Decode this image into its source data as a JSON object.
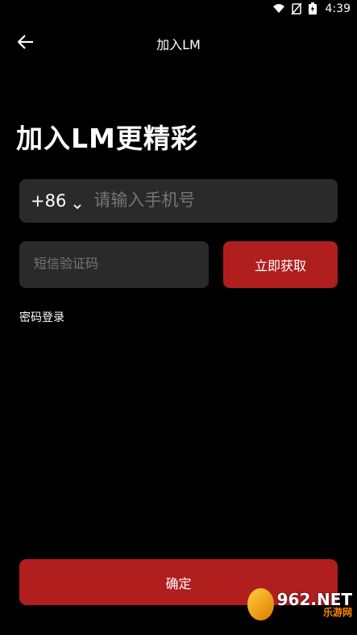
{
  "status": {
    "time": "4:39"
  },
  "header": {
    "title": "加入LM"
  },
  "main": {
    "headline": "加入LM更精彩",
    "phone": {
      "country_code": "+86",
      "placeholder": "请输入手机号"
    },
    "code": {
      "placeholder": "短信验证码",
      "get_label": "立即获取"
    },
    "password_login": "密码登录",
    "confirm_label": "确定"
  },
  "watermark": {
    "brand": "962.NET",
    "sub": "乐游网"
  },
  "colors": {
    "background": "#000000",
    "field": "#2a2a2a",
    "accent": "#b01e1e"
  }
}
